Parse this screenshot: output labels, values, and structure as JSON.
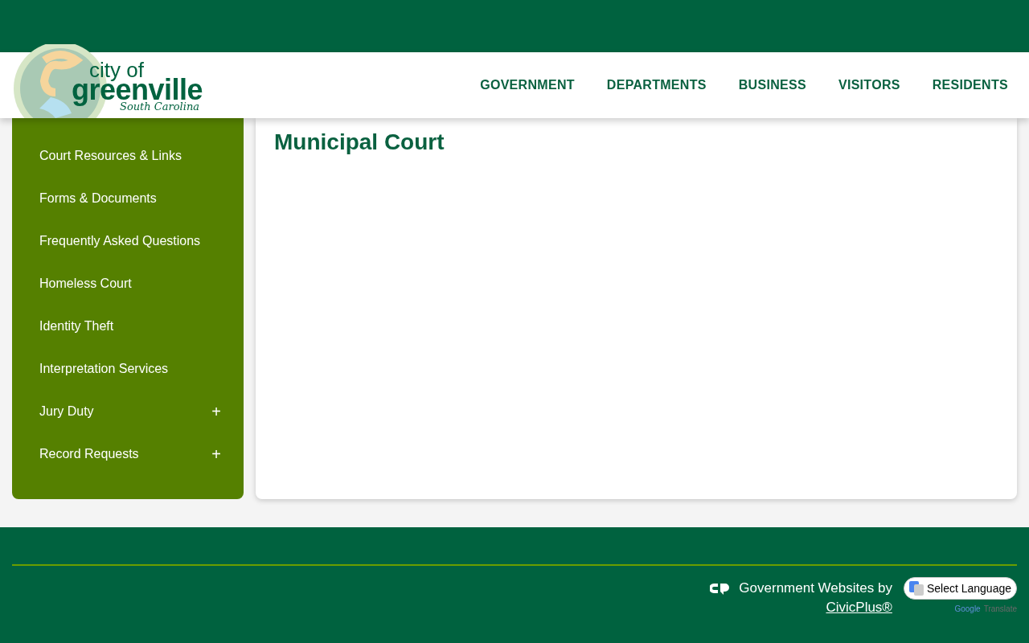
{
  "logo": {
    "line_1": "city of",
    "line_2": "greenville",
    "line_3": "South Carolina"
  },
  "nav": [
    "GOVERNMENT",
    "DEPARTMENTS",
    "BUSINESS",
    "VISITORS",
    "RESIDENTS"
  ],
  "sidebar": {
    "items": [
      {
        "label": "Court Resources & Links"
      },
      {
        "label": "Forms & Documents"
      },
      {
        "label": "Frequently Asked Questions"
      },
      {
        "label": "Homeless Court"
      },
      {
        "label": "Identity Theft"
      },
      {
        "label": "Interpretation Services"
      },
      {
        "label": "Jury Duty",
        "toggle": "+"
      },
      {
        "label": "Record Requests",
        "toggle": "+"
      }
    ]
  },
  "main": {
    "title": "Municipal Court"
  },
  "footer": {
    "credit": "Government Websites by",
    "link": "CivicPlus®",
    "language_select": "Select Language",
    "powered_1": "Google",
    "powered_2": "Translate"
  }
}
